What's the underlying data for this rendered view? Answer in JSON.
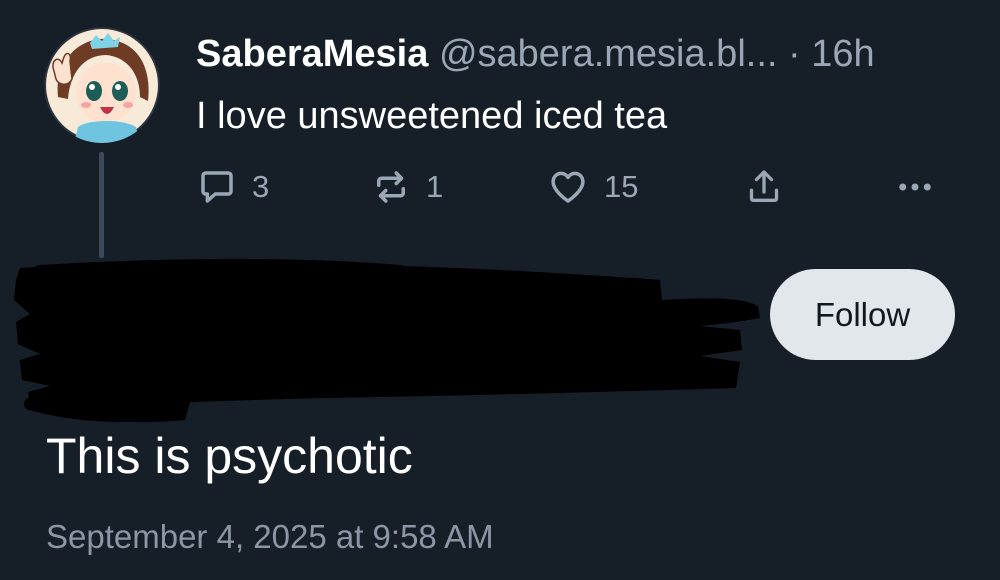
{
  "quoted_post": {
    "author_name": "SaberaMesia",
    "handle": "@sabera.mesia.bl...",
    "separator": "·",
    "time_ago": "16h",
    "text": "I love unsweetened iced tea",
    "actions": {
      "reply_count": "3",
      "repost_count": "1",
      "like_count": "15"
    },
    "icons": [
      "avatar",
      "reply-icon",
      "repost-icon",
      "like-icon",
      "share-icon",
      "more-icon"
    ]
  },
  "reply": {
    "follow_label": "Follow",
    "text": "This is psychotic",
    "timestamp": "September 4, 2025 at 9:58 AM"
  },
  "colors": {
    "background": "#161e27",
    "secondary_text": "#9aa7b6",
    "follow_button_bg": "#e2e7ec",
    "thread_line": "#3d4a59"
  }
}
